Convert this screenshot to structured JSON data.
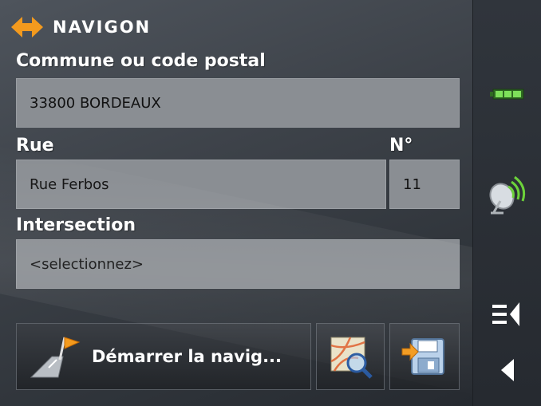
{
  "brand": {
    "name": "NAVIGON"
  },
  "form": {
    "commune_label": "Commune ou code postal",
    "commune_value": "33800 BORDEAUX",
    "rue_label": "Rue",
    "numero_label": "N°",
    "rue_value": "Rue Ferbos",
    "numero_value": "11",
    "intersection_label": "Intersection",
    "intersection_value": "<selectionnez>"
  },
  "actions": {
    "start_nav_label": "Démarrer la navig..."
  },
  "colors": {
    "accent": "#f39a1e",
    "battery": "#55c23a"
  }
}
